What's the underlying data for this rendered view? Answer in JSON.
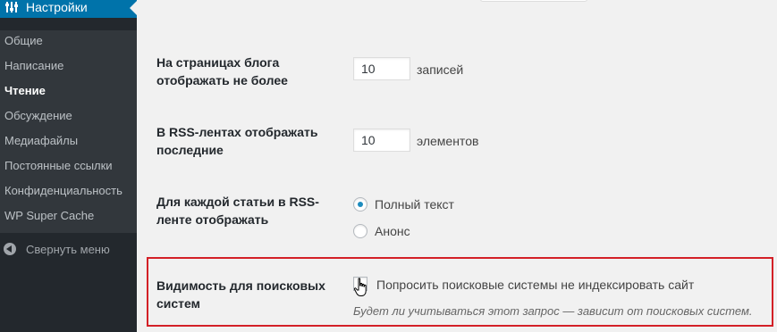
{
  "sidebar": {
    "header_title": "Настройки",
    "header_icon": "settings-sliders-icon",
    "items": [
      {
        "label": "Общие",
        "current": false
      },
      {
        "label": "Написание",
        "current": false
      },
      {
        "label": "Чтение",
        "current": true
      },
      {
        "label": "Обсуждение",
        "current": false
      },
      {
        "label": "Медиафайлы",
        "current": false
      },
      {
        "label": "Постоянные ссылки",
        "current": false
      },
      {
        "label": "Конфиденциальность",
        "current": false
      },
      {
        "label": "WP Super Cache",
        "current": false
      }
    ],
    "collapse_label": "Свернуть меню",
    "collapse_icon": "collapse-arrow-icon"
  },
  "settings": {
    "posts_per_page": {
      "label": "На страницах блога отображать не более",
      "value": "10",
      "unit": "записей"
    },
    "posts_per_rss": {
      "label": "В RSS-лентах отображать последние",
      "value": "10",
      "unit": "элементов"
    },
    "rss_use_excerpt": {
      "label": "Для каждой статьи в RSS-ленте отображать",
      "options": [
        {
          "label": "Полный текст",
          "checked": true
        },
        {
          "label": "Анонс",
          "checked": false
        }
      ]
    },
    "search_visibility": {
      "label": "Видимость для поисковых систем",
      "checkbox_label": "Попросить поисковые системы не индексировать сайт",
      "checked": false,
      "description": "Будет ли учитываться этот запрос — зависит от поисковых систем."
    }
  },
  "colors": {
    "sidebar_bg": "#23282d",
    "submenu_bg": "#32373c",
    "accent": "#0073aa",
    "highlight_border": "#d32027",
    "radio_dot": "#1e8cbe"
  }
}
